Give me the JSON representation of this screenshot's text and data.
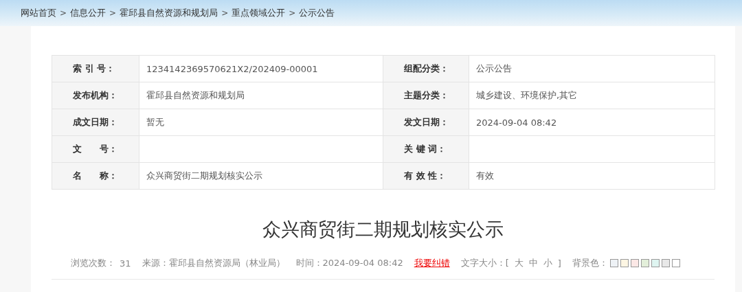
{
  "breadcrumb": [
    {
      "label": "网站首页"
    },
    {
      "separator": ">",
      "label": "信息公开"
    },
    {
      "separator": ">",
      "label": "霍邱县自然资源和规划局"
    },
    {
      "separator": ">",
      "label": "重点领域公开"
    },
    {
      "separator": ">",
      "label": "公示公告"
    }
  ],
  "info_table": [
    [
      {
        "label": "索 引 号：",
        "value": "1234142369570621X2/202409-00001"
      },
      {
        "label": "组配分类：",
        "value": "公示公告"
      }
    ],
    [
      {
        "label": "发布机构：",
        "value": "霍邱县自然资源和规划局"
      },
      {
        "label": "主题分类：",
        "value": "城乡建设、环境保护,其它"
      }
    ],
    [
      {
        "label": "成文日期：",
        "value": "暂无"
      },
      {
        "label": "发文日期：",
        "value": "2024-09-04 08:42"
      }
    ],
    [
      {
        "label": "文　　号："
      },
      {
        "label": "关 键 词："
      }
    ],
    [
      {
        "label": "名　　称：",
        "value": "众兴商贸街二期规划核实公示"
      },
      {
        "label": "有 效 性：",
        "value": "有效"
      }
    ]
  ],
  "article_title": "众兴商贸街二期规划核实公示",
  "meta": {
    "views_label": "浏览次数：",
    "views": "31",
    "source": "来源：霍邱县自然资源局（林业局）",
    "time": "时间：2024-09-04 08:42",
    "correction_link": "我要纠错",
    "font_size_label": "文字大小：[",
    "font_sizes": [
      "大",
      "中",
      "小"
    ],
    "font_size_close": "]",
    "bg_label": "背景色：",
    "bg_colors": [
      {
        "color": "#eef2f6"
      },
      {
        "color": "#fdf6e3"
      },
      {
        "color": "#fce8e6"
      },
      {
        "color": "#e3efda"
      },
      {
        "color": "#dff5f1"
      },
      {
        "color": "#e8e8e8"
      },
      {
        "color": "#ffffff"
      }
    ]
  }
}
